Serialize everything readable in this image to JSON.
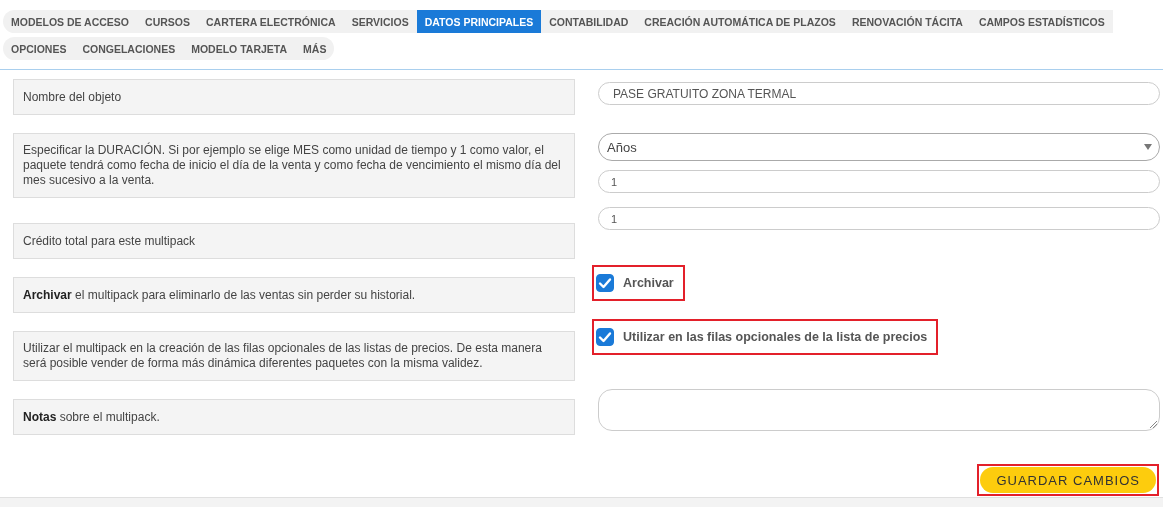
{
  "tab_rows": [
    [
      {
        "label": "MODELOS DE ACCESO",
        "selected": false
      },
      {
        "label": "CURSOS",
        "selected": false
      },
      {
        "label": "CARTERA ELECTRÓNICA",
        "selected": false
      },
      {
        "label": "SERVICIOS",
        "selected": false
      },
      {
        "label": "DATOS PRINCIPALES",
        "selected": true
      },
      {
        "label": "CONTABILIDAD",
        "selected": false
      },
      {
        "label": "CREACIÓN AUTOMÁTICA DE PLAZOS",
        "selected": false
      },
      {
        "label": "RENOVACIÓN TÁCITA",
        "selected": false
      },
      {
        "label": "CAMPOS ESTADÍSTICOS",
        "selected": false
      }
    ],
    [
      {
        "label": "OPCIONES",
        "selected": false
      },
      {
        "label": "CONGELACIONES",
        "selected": false
      },
      {
        "label": "MODELO TARJETA",
        "selected": false
      },
      {
        "label": "MÁS",
        "selected": false
      }
    ]
  ],
  "form_rows": [
    {
      "label": "Nombre del objeto",
      "controls": [
        {
          "kind": "text",
          "value": "PASE GRATUITO ZONA TERMAL"
        }
      ]
    },
    {
      "label": "Especificar la DURACIÓN. Si por ejemplo se elige MES como unidad de tiempo y 1 como valor, el paquete tendrá como fecha de inicio el día de la venta y como fecha de vencimiento el mismo día del mes sucesivo a la venta.",
      "controls": [
        {
          "kind": "select",
          "value": "Años"
        },
        {
          "kind": "number",
          "value": "1"
        }
      ]
    },
    {
      "label": "Crédito total para este multipack",
      "controls": [
        {
          "kind": "number",
          "value": "1"
        }
      ]
    },
    {
      "label": "**Archivar** el multipack para eliminarlo de las ventas sin perder su historial.",
      "controls": [
        {
          "kind": "checkbox",
          "label": "Archivar",
          "checked": true,
          "highlighted": true
        }
      ]
    },
    {
      "label": "Utilizar el multipack en la creación de las filas opcionales de las listas de precios. De esta manera será posible vender de forma más dinámica diferentes paquetes con la misma validez.",
      "controls": [
        {
          "kind": "checkbox",
          "label": "Utilizar en las filas opcionales de la lista de precios",
          "checked": true,
          "highlighted": true
        }
      ]
    },
    {
      "label": "**Notas** sobre el multipack.",
      "controls": [
        {
          "kind": "textarea"
        }
      ]
    }
  ],
  "save_button": {
    "label": "GUARDAR CAMBIOS",
    "highlighted": true
  }
}
